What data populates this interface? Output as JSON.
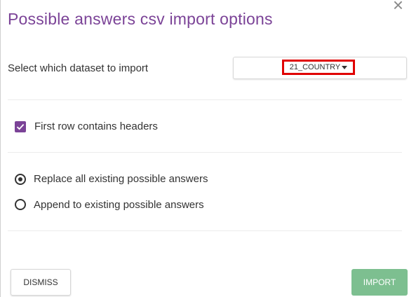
{
  "dialog": {
    "title": "Possible answers csv import options",
    "close_glyph": "×"
  },
  "dataset": {
    "label": "Select which dataset to import",
    "selected_value": "21_COUNTRY"
  },
  "headers_option": {
    "label": "First row contains headers",
    "checked": true
  },
  "import_mode": {
    "options": [
      {
        "label": "Replace all existing possible answers",
        "selected": true
      },
      {
        "label": "Append to existing possible answers",
        "selected": false
      }
    ]
  },
  "buttons": {
    "dismiss_label": "DISMISS",
    "import_label": "IMPORT"
  },
  "colors": {
    "accent": "#7b4397",
    "import_button": "#7dbf90",
    "highlight": "#e00000"
  }
}
